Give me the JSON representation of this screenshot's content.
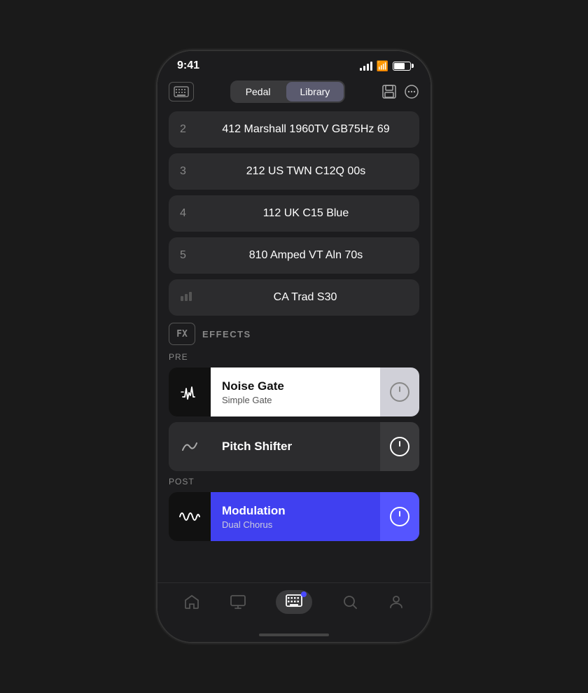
{
  "status": {
    "time": "9:41"
  },
  "topbar": {
    "pedal_label": "Pedal",
    "library_label": "Library",
    "active_tab": "library"
  },
  "cabinets": [
    {
      "num": "2",
      "name": "412 Marshall 1960TV GB75Hz 69",
      "icon": false
    },
    {
      "num": "3",
      "name": "212 US TWN C12Q 00s",
      "icon": false
    },
    {
      "num": "4",
      "name": "112 UK C15 Blue",
      "icon": false
    },
    {
      "num": "5",
      "name": "810 Amped VT Aln 70s",
      "icon": false
    },
    {
      "num": "",
      "name": "CA Trad S30",
      "icon": true
    }
  ],
  "effects": {
    "header_label": "EFFECTS",
    "pre_label": "PRE",
    "post_label": "POST",
    "items_pre": [
      {
        "name": "Noise Gate",
        "sub": "Simple Gate",
        "theme": "white",
        "active": false
      },
      {
        "name": "Pitch Shifter",
        "sub": "",
        "theme": "dark",
        "active": true
      }
    ],
    "items_post": [
      {
        "name": "Modulation",
        "sub": "Dual Chorus",
        "theme": "blue",
        "active": true
      }
    ]
  },
  "nav": {
    "items": [
      {
        "name": "Home",
        "icon": "home"
      },
      {
        "name": "Monitor",
        "icon": "monitor"
      },
      {
        "name": "Keyboard",
        "icon": "keyboard",
        "active": true,
        "bluetooth": true
      },
      {
        "name": "Search",
        "icon": "search"
      },
      {
        "name": "Profile",
        "icon": "person"
      }
    ]
  }
}
